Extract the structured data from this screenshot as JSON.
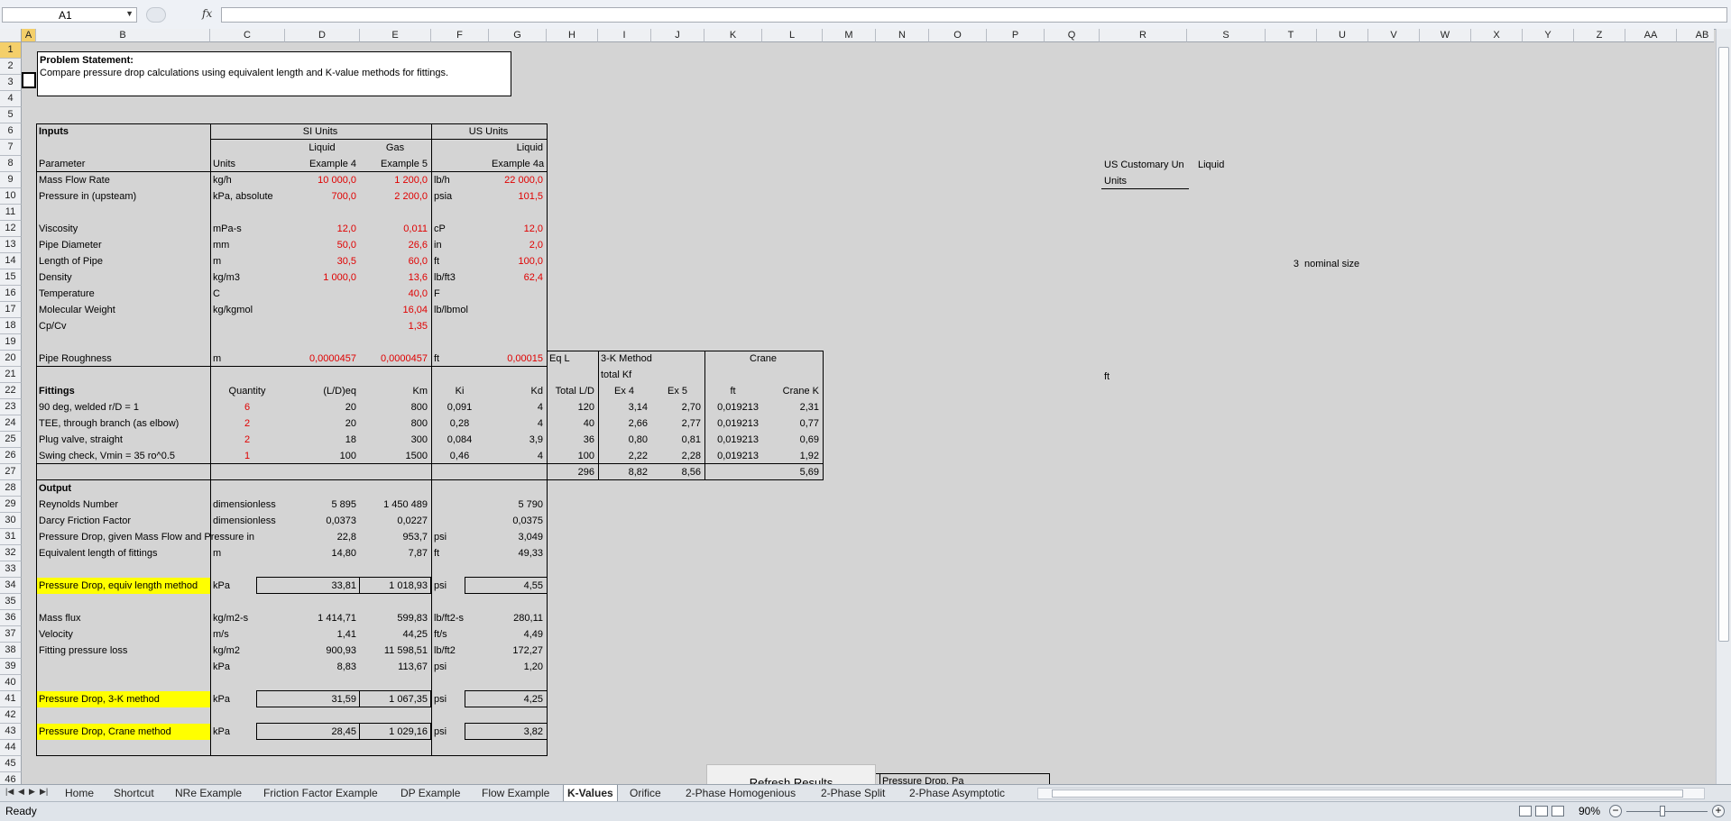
{
  "formula_bar": {
    "name_box": "A1",
    "fx_label": "fx",
    "formula": ""
  },
  "columns": [
    "A",
    "B",
    "C",
    "D",
    "E",
    "F",
    "G",
    "H",
    "I",
    "J",
    "K",
    "L",
    "M",
    "N",
    "O",
    "P",
    "Q",
    "R",
    "S",
    "T",
    "U",
    "V",
    "W",
    "X",
    "Y",
    "Z",
    "AA",
    "AB"
  ],
  "problem": {
    "title": "Problem Statement:",
    "text": "Compare pressure drop calculations using equivalent length and K-value methods for fittings."
  },
  "table": {
    "inputs": "Inputs",
    "si_units": "SI Units",
    "us_units": "US Units",
    "liquid": "Liquid",
    "gas": "Gas",
    "liquid_us": "Liquid",
    "parameter": "Parameter",
    "units": "Units",
    "ex4": "Example 4",
    "ex5": "Example 5",
    "ex4a": "Example 4a",
    "input_rows": [
      {
        "name": "Mass Flow Rate",
        "si_unit": "kg/h",
        "ex4": "10 000,0",
        "ex5": "1 200,0",
        "us_unit": "lb/h",
        "us": "22 000,0"
      },
      {
        "name": "Pressure in (upsteam)",
        "si_unit": "kPa, absolute",
        "ex4": "700,0",
        "ex5": "2 200,0",
        "us_unit": "psia",
        "us": "101,5"
      },
      {
        "name": "Viscosity",
        "si_unit": "mPa-s",
        "ex4": "12,0",
        "ex5": "0,011",
        "us_unit": "cP",
        "us": "12,0"
      },
      {
        "name": "Pipe Diameter",
        "si_unit": "mm",
        "ex4": "50,0",
        "ex5": "26,6",
        "us_unit": "in",
        "us": "2,0"
      },
      {
        "name": "Length of Pipe",
        "si_unit": "m",
        "ex4": "30,5",
        "ex5": "60,0",
        "us_unit": "ft",
        "us": "100,0"
      },
      {
        "name": "Density",
        "si_unit": "kg/m3",
        "ex4": "1 000,0",
        "ex5": "13,6",
        "us_unit": "lb/ft3",
        "us": "62,4"
      },
      {
        "name": "Temperature",
        "si_unit": "C",
        "ex4": "",
        "ex5": "40,0",
        "us_unit": "F",
        "us": ""
      },
      {
        "name": "Molecular Weight",
        "si_unit": "kg/kgmol",
        "ex4": "",
        "ex5": "16,04",
        "us_unit": "lb/lbmol",
        "us": ""
      },
      {
        "name": "Cp/Cv",
        "si_unit": "",
        "ex4": "",
        "ex5": "1,35",
        "us_unit": "",
        "us": ""
      }
    ],
    "roughness": {
      "name": "Pipe Roughness",
      "si_unit": "m",
      "ex4": "0,0000457",
      "ex5": "0,0000457",
      "us_unit": "ft",
      "us": "0,00015"
    },
    "fittings_header": {
      "title": "Fittings",
      "quantity": "Quantity",
      "ld": "(L/D)eq",
      "km": "Km",
      "ki": "Ki",
      "kd": "Kd"
    },
    "fittings": [
      {
        "name": "90 deg, welded r/D = 1",
        "qty": "6",
        "ld": "20",
        "km": "800",
        "ki": "0,091",
        "kd": "4"
      },
      {
        "name": "TEE, through branch (as elbow)",
        "qty": "2",
        "ld": "20",
        "km": "800",
        "ki": "0,28",
        "kd": "4"
      },
      {
        "name": "Plug valve, straight",
        "qty": "2",
        "ld": "18",
        "km": "300",
        "ki": "0,084",
        "kd": "3,9"
      },
      {
        "name": "Swing check, Vmin = 35 ro^0.5",
        "qty": "1",
        "ld": "100",
        "km": "1500",
        "ki": "0,46",
        "kd": "4"
      }
    ],
    "output": "Output",
    "output_rows": [
      {
        "name": "Reynolds Number",
        "unit": "dimensionless",
        "ex4": "5 895",
        "ex5": "1 450 489",
        "us_unit": "",
        "us": "5 790"
      },
      {
        "name": "Darcy Friction Factor",
        "unit": "dimensionless",
        "ex4": "0,0373",
        "ex5": "0,0227",
        "us_unit": "",
        "us": "0,0375"
      },
      {
        "name": "Pressure Drop, given Mass Flow and Pressure in",
        "unit": "",
        "ex4": "22,8",
        "ex5": "953,7",
        "us_unit": "psi",
        "us": "3,049"
      },
      {
        "name": "Equivalent length of fittings",
        "unit": "m",
        "ex4": "14,80",
        "ex5": "7,87",
        "us_unit": "ft",
        "us": "49,33"
      }
    ],
    "pd_equiv": {
      "name": "Pressure Drop, equiv length method",
      "unit": "kPa",
      "ex4": "33,81",
      "ex5": "1 018,93",
      "us_unit": "psi",
      "us": "4,55"
    },
    "flux_rows": [
      {
        "name": "Mass flux",
        "unit": "kg/m2-s",
        "ex4": "1 414,71",
        "ex5": "599,83",
        "us_unit": "lb/ft2-s",
        "us": "280,11"
      },
      {
        "name": "Velocity",
        "unit": "m/s",
        "ex4": "1,41",
        "ex5": "44,25",
        "us_unit": "ft/s",
        "us": "4,49"
      },
      {
        "name": "Fitting pressure loss",
        "unit": "kg/m2",
        "ex4": "900,93",
        "ex5": "11 598,51",
        "us_unit": "lb/ft2",
        "us": "172,27"
      },
      {
        "name": "",
        "unit": "kPa",
        "ex4": "8,83",
        "ex5": "113,67",
        "us_unit": "psi",
        "us": "1,20"
      }
    ],
    "pd_3k": {
      "name": "Pressure Drop, 3-K method",
      "unit": "kPa",
      "ex4": "31,59",
      "ex5": "1 067,35",
      "us_unit": "psi",
      "us": "4,25"
    },
    "pd_crane": {
      "name": "Pressure Drop, Crane method",
      "unit": "kPa",
      "ex4": "28,45",
      "ex5": "1 029,16",
      "us_unit": "psi",
      "us": "3,82"
    }
  },
  "side_table": {
    "eq_l": "Eq L",
    "three_k": "3-K Method",
    "crane": "Crane",
    "total_kf": "total Kf",
    "total_ld": "Total L/D",
    "ex4": "Ex 4",
    "ex5": "Ex 5",
    "ft": "ft",
    "crane_k": "Crane K",
    "rows": [
      {
        "ld": "120",
        "ex4": "3,14",
        "ex5": "2,70",
        "ft": "0,019213",
        "ck": "2,31"
      },
      {
        "ld": "40",
        "ex4": "2,66",
        "ex5": "2,77",
        "ft": "0,019213",
        "ck": "0,77"
      },
      {
        "ld": "36",
        "ex4": "0,80",
        "ex5": "0,81",
        "ft": "0,019213",
        "ck": "0,69"
      },
      {
        "ld": "100",
        "ex4": "2,22",
        "ex5": "2,28",
        "ft": "0,019213",
        "ck": "1,92"
      }
    ],
    "totals": {
      "ld": "296",
      "ex4": "8,82",
      "ex5": "8,56",
      "ck": "5,69"
    }
  },
  "right_notes": {
    "us_customary": "US Customary Un",
    "liquid": "Liquid",
    "units": "Units",
    "nominal_num": "3",
    "nominal_text": "nominal size",
    "ft": "ft"
  },
  "refresh_button": "Refresh Results",
  "partial_box_label": "Pressure Drop, Pa",
  "tabs": [
    "Home",
    "Shortcut",
    "NRe Example",
    "Friction Factor Example",
    "DP Example",
    "Flow Example",
    "K-Values",
    "Orifice",
    "2-Phase Homogenious",
    "2-Phase Split",
    "2-Phase Asymptotic"
  ],
  "active_tab": "K-Values",
  "status": "Ready",
  "zoom": "90%"
}
